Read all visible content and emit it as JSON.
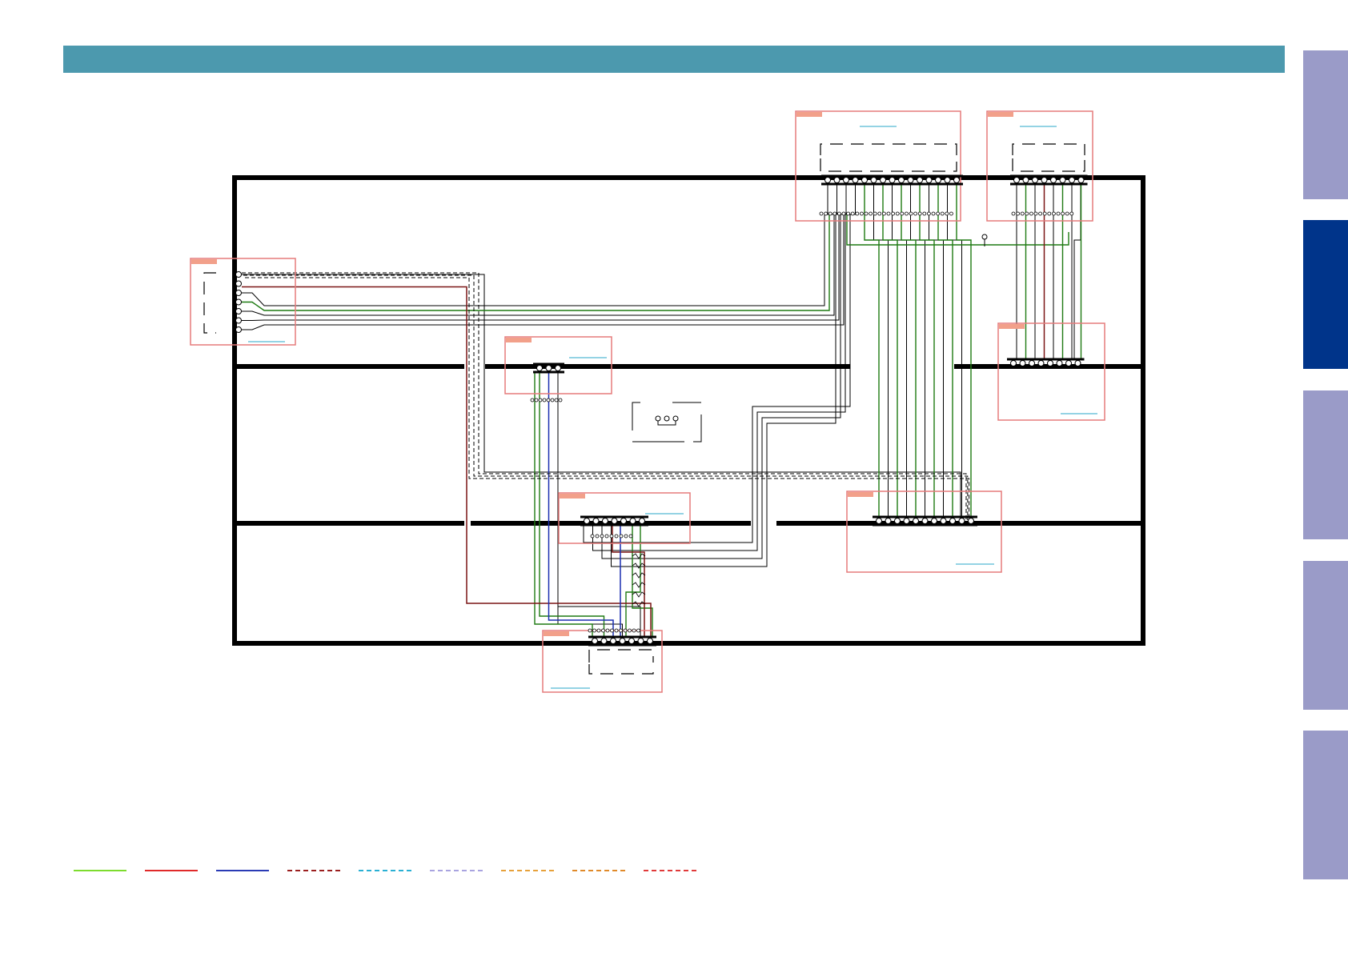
{
  "header": {
    "color": "#4c99ae"
  },
  "side_tabs": [
    {
      "state": "inactive",
      "color": "#9a9bc8"
    },
    {
      "state": "active",
      "color": "#00348a"
    },
    {
      "state": "inactive",
      "color": "#9a9bc8"
    },
    {
      "state": "inactive",
      "color": "#9a9bc8"
    },
    {
      "state": "inactive",
      "color": "#9a9bc8"
    }
  ],
  "wire_colors": {
    "black": "#000000",
    "green": "#1e7a12",
    "dark_red": "#7a1515",
    "blue": "#1a2fb0",
    "board_outline": "#e57b7b",
    "board_tag": "#f2a08a",
    "link_line": "#2aa7c9"
  },
  "legend": {
    "solid": [
      "#7ddc2e",
      "#e02a2a",
      "#2a3bb5"
    ],
    "dashed": [
      "#9b1f1f",
      "#2ab0d4",
      "#a9a4e0",
      "#e7a13a",
      "#e08a2a",
      "#e03a3a"
    ]
  }
}
